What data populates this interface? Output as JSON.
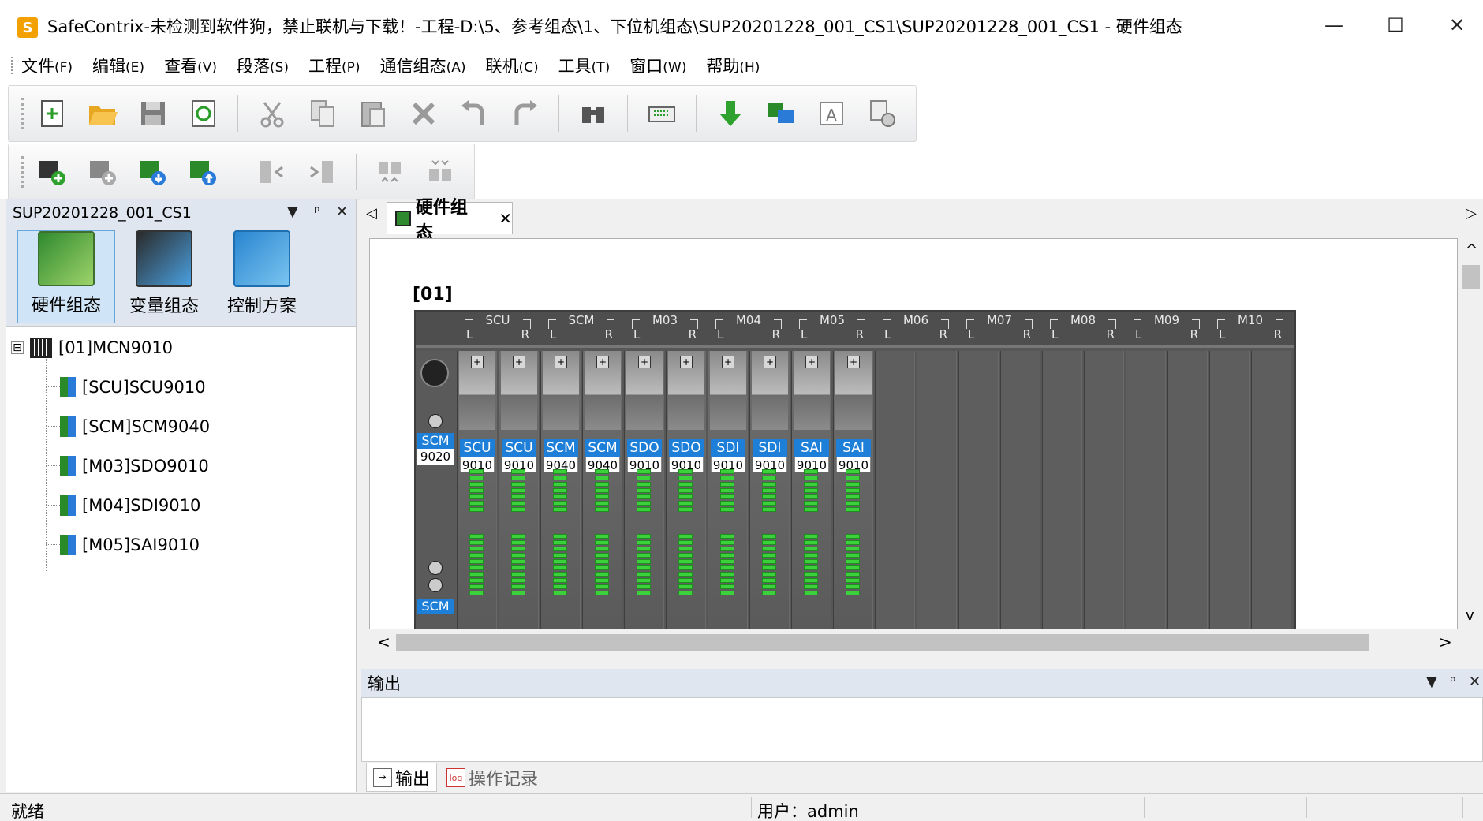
{
  "window": {
    "app_icon_letter": "S",
    "title": "SafeContrix-未检测到软件狗，禁止联机与下载！-工程-D:\\5、参考组态\\1、下位机组态\\SUP20201228_001_CS1\\SUP20201228_001_CS1 - 硬件组态",
    "minimize": "—",
    "maximize": "☐",
    "close": "✕"
  },
  "menu": [
    {
      "label": "文件",
      "key": "(F)"
    },
    {
      "label": "编辑",
      "key": "(E)"
    },
    {
      "label": "查看",
      "key": "(V)"
    },
    {
      "label": "段落",
      "key": "(S)"
    },
    {
      "label": "工程",
      "key": "(P)"
    },
    {
      "label": "通信组态",
      "key": "(A)"
    },
    {
      "label": "联机",
      "key": "(C)"
    },
    {
      "label": "工具",
      "key": "(T)"
    },
    {
      "label": "窗口",
      "key": "(W)"
    },
    {
      "label": "帮助",
      "key": "(H)"
    }
  ],
  "toolbar1_icons": [
    "new-file-icon",
    "open-folder-icon",
    "save-icon",
    "refresh-icon",
    "cut-icon",
    "copy-icon",
    "paste-icon",
    "delete-icon",
    "undo-icon",
    "redo-icon",
    "find-icon",
    "compile-icon",
    "download-icon",
    "online-icon",
    "text-icon",
    "settings-icon"
  ],
  "toolbar2_icons": [
    "add-rack-icon",
    "add-module-icon",
    "import-icon",
    "export-icon",
    "move-left-icon",
    "move-right-icon",
    "collapse-icon",
    "expand-icon"
  ],
  "left_panel": {
    "title": "SUP20201228_001_CS1",
    "ctrl_dropdown": "▼",
    "ctrl_pin": "ᵖ",
    "ctrl_close": "✕",
    "nav": [
      {
        "label": "硬件组态",
        "active": true
      },
      {
        "label": "变量组态",
        "active": false
      },
      {
        "label": "控制方案",
        "active": false
      }
    ],
    "tree_root": "[01]MCN9010",
    "tree_root_expander": "⊟",
    "tree_children": [
      "[SCU]SCU9010",
      "[SCM]SCM9040",
      "[M03]SDO9010",
      "[M04]SDI9010",
      "[M05]SAI9010"
    ]
  },
  "doc_tab": {
    "scroll_left": "◁",
    "scroll_right": "▷",
    "label": "硬件组态",
    "close": "✕"
  },
  "rack": {
    "label": "[01]",
    "slot_headers": [
      "SCU",
      "SCM",
      "M03",
      "M04",
      "M05",
      "M06",
      "M07",
      "M08",
      "M09",
      "M10"
    ],
    "slot_l": "L",
    "slot_r": "R",
    "power_type": "SCM",
    "power_model": "9020",
    "power_type_bottom": "SCM",
    "modules": [
      {
        "type": "SCU",
        "model": "9010"
      },
      {
        "type": "SCU",
        "model": "9010"
      },
      {
        "type": "SCM",
        "model": "9040"
      },
      {
        "type": "SCM",
        "model": "9040"
      },
      {
        "type": "SDO",
        "model": "9010"
      },
      {
        "type": "SDO",
        "model": "9010"
      },
      {
        "type": "SDI",
        "model": "9010"
      },
      {
        "type": "SDI",
        "model": "9010"
      },
      {
        "type": "SAI",
        "model": "9010"
      },
      {
        "type": "SAI",
        "model": "9010"
      }
    ],
    "empty_slots": 10
  },
  "scroll": {
    "up": "^",
    "down": "v",
    "left": "<",
    "right": ">"
  },
  "output": {
    "title": "输出",
    "ctrl_dropdown": "▼",
    "ctrl_pin": "ᵖ",
    "ctrl_close": "✕",
    "tabs": [
      {
        "label": "输出",
        "icon": "→",
        "active": true
      },
      {
        "label": "操作记录",
        "icon": "log",
        "active": false
      }
    ]
  },
  "status": {
    "left": "就绪",
    "user": "用户：admin"
  },
  "colors": {
    "accent_blue": "#1e7fd8",
    "led_green": "#3bd13b",
    "rack_gray": "#575757",
    "panel_header": "#dfe6ef"
  }
}
